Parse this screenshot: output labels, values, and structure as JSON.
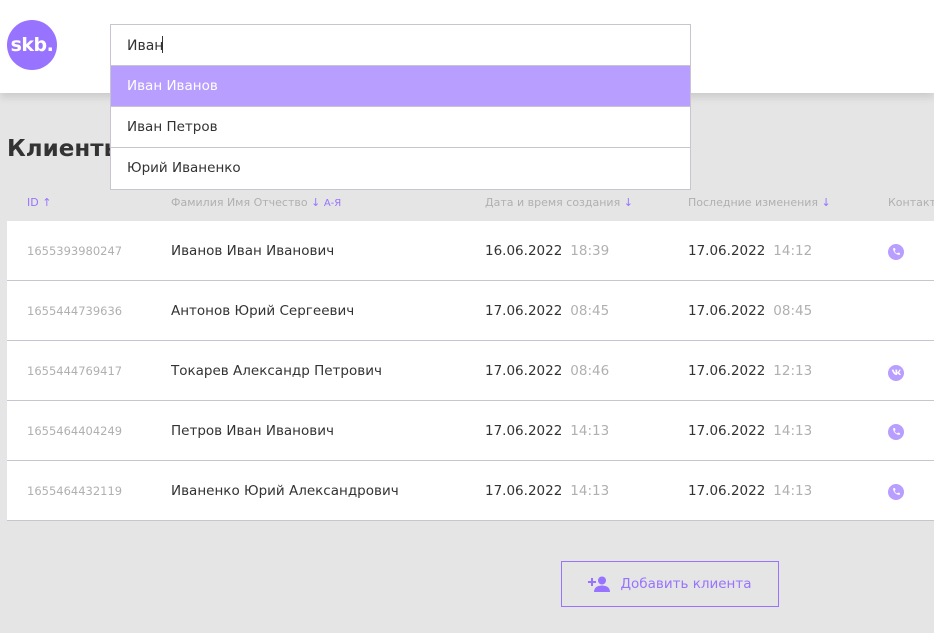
{
  "header": {
    "logo_text": "skb.",
    "search": {
      "value": "Иван",
      "placeholder": ""
    },
    "suggestions": [
      {
        "label": "Иван Иванов",
        "active": true
      },
      {
        "label": "Иван Петров",
        "active": false
      },
      {
        "label": "Юрий Иваненко",
        "active": false
      }
    ]
  },
  "main": {
    "title": "Клиенты",
    "columns": {
      "id": "ID",
      "id_sort_arrow": "↑",
      "name": "Фамилия Имя Отчество",
      "name_sort_arrow": "↓",
      "name_sort_hint": "А-Я",
      "created": "Дата и время создания",
      "created_sort_arrow": "↓",
      "updated": "Последние изменения",
      "updated_sort_arrow": "↓",
      "contacts": "Контакты"
    },
    "rows": [
      {
        "id": "1655393980247",
        "name": "Иванов Иван Иванович",
        "created_date": "16.06.2022",
        "created_time": "18:39",
        "updated_date": "17.06.2022",
        "updated_time": "14:12",
        "contact": "phone-icon"
      },
      {
        "id": "1655444739636",
        "name": "Антонов Юрий Сергеевич",
        "created_date": "17.06.2022",
        "created_time": "08:45",
        "updated_date": "17.06.2022",
        "updated_time": "08:45",
        "contact": ""
      },
      {
        "id": "1655444769417",
        "name": "Токарев Александр Петрович",
        "created_date": "17.06.2022",
        "created_time": "08:46",
        "updated_date": "17.06.2022",
        "updated_time": "12:13",
        "contact": "vk-icon"
      },
      {
        "id": "1655464404249",
        "name": "Петров Иван Иванович",
        "created_date": "17.06.2022",
        "created_time": "14:13",
        "updated_date": "17.06.2022",
        "updated_time": "14:13",
        "contact": "phone-icon"
      },
      {
        "id": "1655464432119",
        "name": "Иваненко Юрий Александрович",
        "created_date": "17.06.2022",
        "created_time": "14:13",
        "updated_date": "17.06.2022",
        "updated_time": "14:13",
        "contact": "phone-icon"
      }
    ],
    "add_button_label": "Добавить клиента"
  },
  "colors": {
    "accent": "#9873ff",
    "accent_light": "#b89eff",
    "background": "#e5e5e5",
    "border": "#c8c5d1",
    "muted_text": "#b0b0b0"
  }
}
